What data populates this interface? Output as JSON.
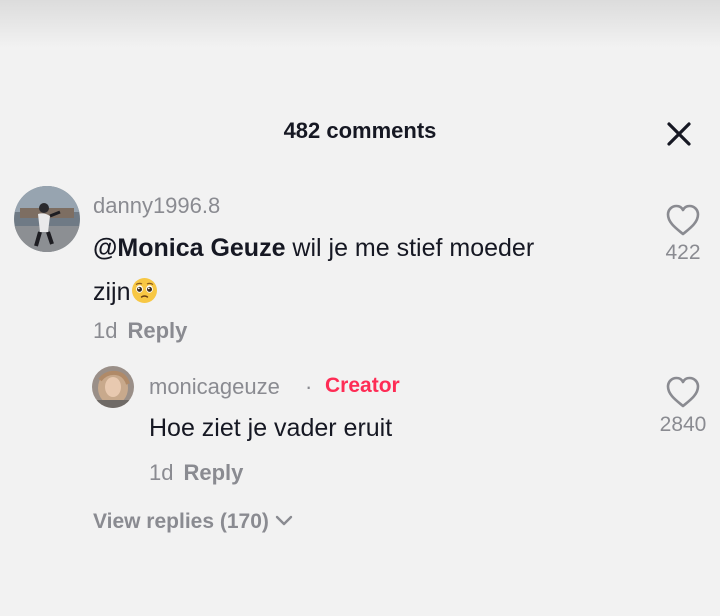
{
  "header": {
    "title": "482 comments"
  },
  "comments": [
    {
      "username": "danny1996.8",
      "mention": "@Monica Geuze",
      "text_line1": " wil je me stief moeder",
      "text_line2": "zijn",
      "emoji": "pleading-face-emoji",
      "time": "1d",
      "reply_label": "Reply",
      "likes": "422"
    }
  ],
  "reply": {
    "username": "monicageuze",
    "separator": "·",
    "badge": "Creator",
    "text": "Hoe ziet je vader eruit",
    "time": "1d",
    "reply_label": "Reply",
    "likes": "2840"
  },
  "view_replies": {
    "label": "View replies (170)"
  },
  "colors": {
    "background": "#f2f2f2",
    "text_primary": "#161823",
    "text_secondary": "#8a8b91",
    "creator_accent": "#fe2c55"
  },
  "icons": {
    "close": "close-icon",
    "like": "heart-outline-icon",
    "expand": "chevron-down-icon"
  }
}
